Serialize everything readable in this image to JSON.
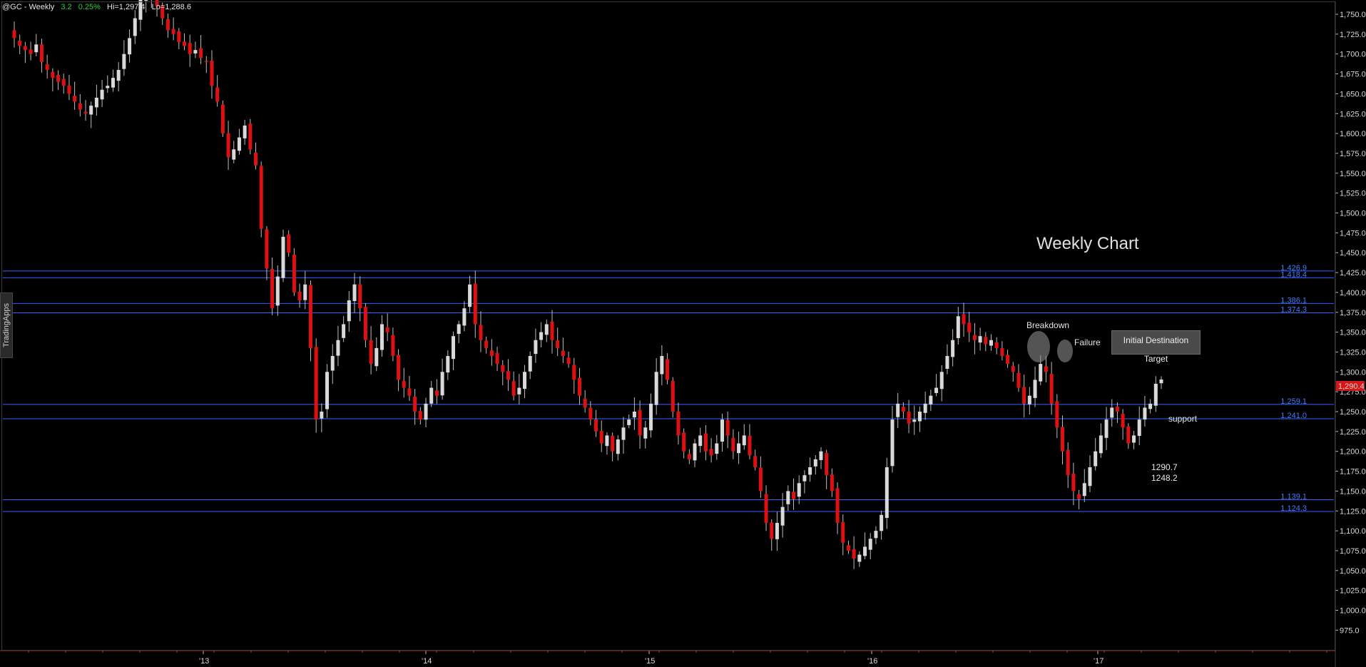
{
  "header": {
    "symbol": "@GC - Weekly",
    "change": "3.2",
    "change_pct": "0.25%",
    "hi": "Hi=1,297.4",
    "lo": "Lo=1,288.6"
  },
  "sidebar_tab": {
    "label": "TradingApps"
  },
  "annotations": {
    "title": "Weekly Chart",
    "breakdown": "Breakdown",
    "failure": "Failure",
    "target": "Initial Destination Target",
    "support": "support",
    "value1": "1290.7",
    "value2": "1248.2"
  },
  "current_price_badge": "1,290.4",
  "colors": {
    "background": "#000000",
    "up_candle": "#d9d9d9",
    "down_candle": "#e01010",
    "level_line": "#2f66ff",
    "axis_text": "#d8d8d8"
  },
  "chart_data": {
    "type": "candlestick",
    "title": "",
    "xlabel": "",
    "ylabel": "",
    "ylim": [
      962.5,
      1762.5
    ],
    "y_ticks": [
      "1,750.0",
      "1,725.0",
      "1,700.0",
      "1,675.0",
      "1,650.0",
      "1,625.0",
      "1,600.0",
      "1,575.0",
      "1,550.0",
      "1,525.0",
      "1,500.0",
      "1,475.0",
      "1,450.0",
      "1,425.0",
      "1,400.0",
      "1,375.0",
      "1,350.0",
      "1,325.0",
      "1,300.0",
      "1,275.0",
      "1,250.0",
      "1,225.0",
      "1,200.0",
      "1,175.0",
      "1,150.0",
      "1,125.0",
      "1,100.0",
      "1,075.0",
      "1,050.0",
      "1,025.0",
      "1,000.0",
      "975.0"
    ],
    "x_ticks": [
      "'13",
      "'14",
      "'15",
      "'16",
      "'17"
    ],
    "horizontal_levels": [
      {
        "value": 1426.9,
        "label": "1,426.9"
      },
      {
        "value": 1418.4,
        "label": "1,418.4"
      },
      {
        "value": 1386.1,
        "label": "1,386.1"
      },
      {
        "value": 1374.3,
        "label": "1,374.3"
      },
      {
        "value": 1259.1,
        "label": "1,259.1"
      },
      {
        "value": 1241.0,
        "label": "1,241.0"
      },
      {
        "value": 1139.1,
        "label": "1,139.1"
      },
      {
        "value": 1124.3,
        "label": "1,124.3"
      }
    ],
    "price_path_closes": [
      1720,
      1710,
      1705,
      1700,
      1712,
      1690,
      1680,
      1670,
      1665,
      1660,
      1650,
      1640,
      1630,
      1625,
      1635,
      1645,
      1655,
      1660,
      1670,
      1680,
      1700,
      1720,
      1745,
      1770,
      1775,
      1775,
      1760,
      1745,
      1730,
      1725,
      1715,
      1710,
      1700,
      1705,
      1695,
      1690,
      1660,
      1640,
      1600,
      1570,
      1580,
      1595,
      1610,
      1580,
      1560,
      1480,
      1430,
      1380,
      1420,
      1470,
      1450,
      1400,
      1390,
      1410,
      1330,
      1240,
      1250,
      1300,
      1320,
      1340,
      1360,
      1390,
      1410,
      1380,
      1340,
      1310,
      1330,
      1360,
      1350,
      1320,
      1290,
      1280,
      1270,
      1250,
      1240,
      1260,
      1280,
      1270,
      1300,
      1320,
      1345,
      1360,
      1380,
      1410,
      1360,
      1340,
      1330,
      1320,
      1310,
      1300,
      1290,
      1270,
      1280,
      1300,
      1320,
      1340,
      1350,
      1360,
      1340,
      1330,
      1320,
      1310,
      1290,
      1270,
      1255,
      1240,
      1225,
      1210,
      1220,
      1200,
      1215,
      1230,
      1240,
      1250,
      1220,
      1230,
      1260,
      1300,
      1320,
      1290,
      1250,
      1220,
      1200,
      1190,
      1210,
      1220,
      1200,
      1195,
      1210,
      1240,
      1220,
      1200,
      1210,
      1220,
      1195,
      1180,
      1150,
      1110,
      1090,
      1110,
      1130,
      1150,
      1140,
      1160,
      1170,
      1180,
      1190,
      1200,
      1170,
      1150,
      1110,
      1085,
      1075,
      1065,
      1070,
      1080,
      1090,
      1100,
      1120,
      1180,
      1240,
      1260,
      1250,
      1235,
      1240,
      1250,
      1260,
      1270,
      1280,
      1300,
      1320,
      1340,
      1370,
      1360,
      1350,
      1340,
      1345,
      1335,
      1340,
      1330,
      1320,
      1310,
      1300,
      1280,
      1260,
      1270,
      1290,
      1310,
      1300,
      1260,
      1230,
      1200,
      1170,
      1150,
      1140,
      1160,
      1180,
      1200,
      1220,
      1240,
      1255,
      1250,
      1230,
      1210,
      1220,
      1240,
      1255,
      1260,
      1285,
      1290.4
    ]
  }
}
